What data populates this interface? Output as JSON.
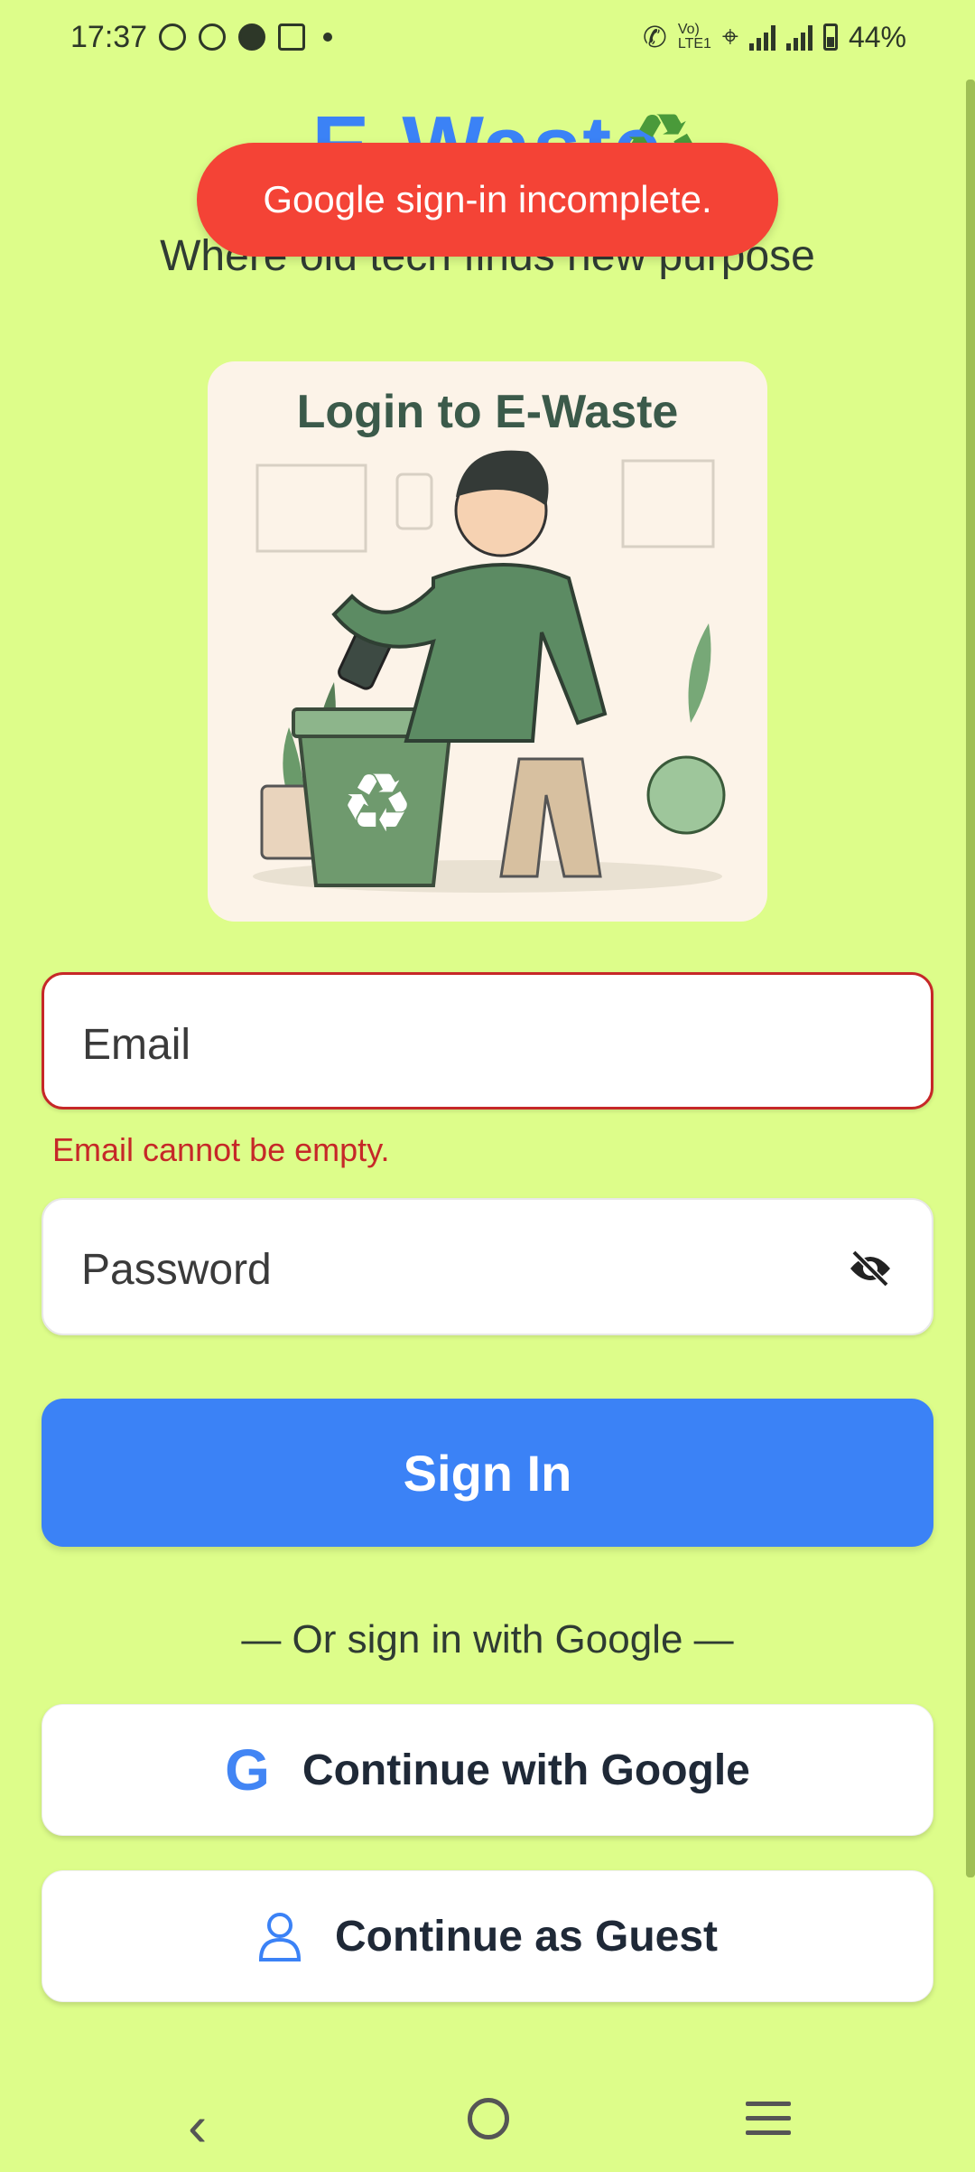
{
  "status_bar": {
    "time": "17:37",
    "battery": "44%",
    "left_icons": [
      "chat-icon",
      "whatsapp-icon",
      "app-icon",
      "gmail-icon",
      "dot-icon"
    ],
    "right_icons": [
      "call-icon",
      "volte-icon",
      "wifi-icon",
      "signal-icon",
      "signal-icon",
      "battery-icon"
    ]
  },
  "header": {
    "app_title": "E-Waste",
    "tagline": "Where old tech finds new purpose"
  },
  "toast": {
    "message": "Google sign-in incomplete."
  },
  "illustration": {
    "title": "Login to E-Waste"
  },
  "form": {
    "email_placeholder": "Email",
    "email_error": "Email cannot be empty.",
    "password_placeholder": "Password",
    "sign_in_label": "Sign In",
    "divider_text": "— Or sign in with Google —",
    "google_label": "Continue with Google",
    "guest_label": "Continue as Guest"
  },
  "colors": {
    "background": "#ddfd8a",
    "primary": "#3b82f6",
    "error": "#c62828",
    "toast": "#f44336"
  }
}
